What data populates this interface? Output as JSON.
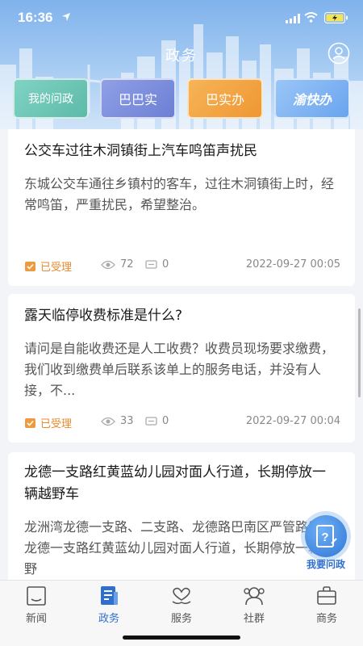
{
  "status_bar": {
    "time": "16:36"
  },
  "header": {
    "title": "政务",
    "quick_buttons": [
      "我的问政",
      "巴巴实",
      "巴实办",
      "渝快办"
    ]
  },
  "cards": [
    {
      "title": "公交车过往木洞镇街上汽车鸣笛声扰民",
      "desc": "东城公交车通往乡镇村的客车，过往木洞镇街上时，经常鸣笛，严重扰民，希望整治。",
      "status": "已受理",
      "views": "72",
      "comments": "0",
      "date": "2022-09-27 00:05"
    },
    {
      "title": "露天临停收费标准是什么?",
      "desc": "请问是自能收费还是人工收费？收费员现场要求缴费，我们收到缴费单后联系该单上的服务电话，并没有人接，不...",
      "status": "已受理",
      "views": "33",
      "comments": "0",
      "date": "2022-09-27 00:04"
    },
    {
      "title": "龙德一支路红黄蓝幼儿园对面人行道，长期停放一辆越野车",
      "desc": "龙洲湾龙德一支路、二支路、龙德路巴南区严管路段，龙德一支路红黄蓝幼儿园对面人行道，长期停放一辆越野"
    }
  ],
  "fab": {
    "label": "我要问政"
  },
  "tabs": [
    {
      "label": "新闻",
      "icon": "news-icon"
    },
    {
      "label": "政务",
      "icon": "gov-icon",
      "active": true
    },
    {
      "label": "服务",
      "icon": "service-icon"
    },
    {
      "label": "社群",
      "icon": "community-icon"
    },
    {
      "label": "商务",
      "icon": "business-icon"
    }
  ],
  "colors": {
    "accent": "#2f6fd0",
    "status": "#e88a2e",
    "header_top": "#7fb2ec"
  }
}
